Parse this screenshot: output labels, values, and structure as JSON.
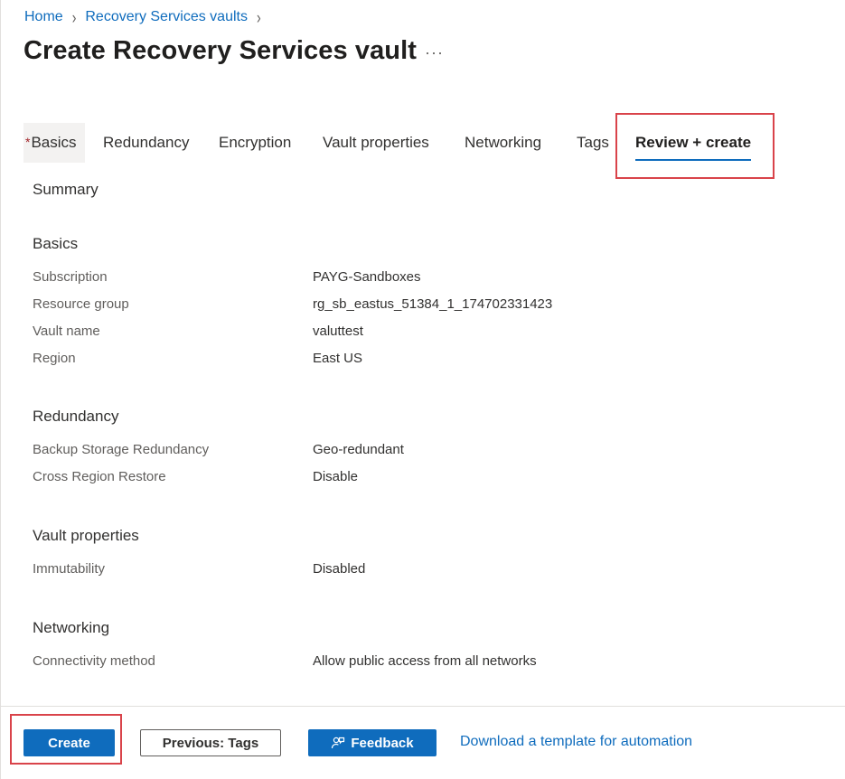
{
  "breadcrumb": {
    "home": "Home",
    "vaults": "Recovery Services vaults"
  },
  "page": {
    "title": "Create Recovery Services vault",
    "more": "···"
  },
  "tabs": {
    "basics": "Basics",
    "required_marker": "*",
    "redundancy": "Redundancy",
    "encryption": "Encryption",
    "vault_properties": "Vault properties",
    "networking": "Networking",
    "tags": "Tags",
    "review_create": "Review + create"
  },
  "summary": {
    "heading": "Summary",
    "basics": {
      "title": "Basics",
      "subscription_label": "Subscription",
      "subscription_value": "PAYG-Sandboxes",
      "resource_group_label": "Resource group",
      "resource_group_value": "rg_sb_eastus_51384_1_174702331423",
      "vault_name_label": "Vault name",
      "vault_name_value": "valuttest",
      "region_label": "Region",
      "region_value": "East US"
    },
    "redundancy": {
      "title": "Redundancy",
      "backup_label": "Backup Storage Redundancy",
      "backup_value": "Geo-redundant",
      "crr_label": "Cross Region Restore",
      "crr_value": "Disable"
    },
    "vault_properties": {
      "title": "Vault properties",
      "immutability_label": "Immutability",
      "immutability_value": "Disabled"
    },
    "networking": {
      "title": "Networking",
      "connectivity_label": "Connectivity method",
      "connectivity_value": "Allow public access from all networks"
    }
  },
  "footer": {
    "create": "Create",
    "previous": "Previous: Tags",
    "feedback": "Feedback",
    "download": "Download a template for automation"
  },
  "colors": {
    "accent": "#0f6cbd",
    "highlight_border": "#d9434a",
    "required": "#a4262c"
  }
}
